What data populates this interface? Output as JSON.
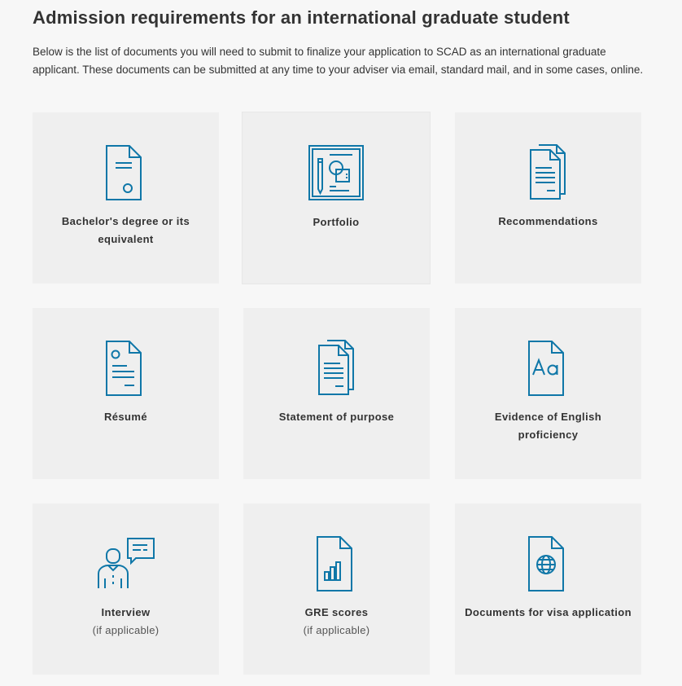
{
  "page": {
    "title": "Admission requirements for an international graduate student",
    "intro": "Below is the list of documents you will need to submit to finalize your application to SCAD as an international graduate applicant. These documents can be submitted at any time to your adviser via email, standard mail, and in some cases, online."
  },
  "theme": {
    "accent": "#0f77a8",
    "card_background": "#efefef",
    "page_background": "#f7f7f7"
  },
  "requirements": [
    {
      "label": "Bachelor's degree or its equivalent",
      "note": "",
      "icon": "diploma-document-icon"
    },
    {
      "label": "Portfolio",
      "note": "",
      "icon": "portfolio-drawing-icon"
    },
    {
      "label": "Recommendations",
      "note": "",
      "icon": "stacked-letters-icon"
    },
    {
      "label": "Résumé",
      "note": "",
      "icon": "resume-document-icon"
    },
    {
      "label": "Statement of purpose",
      "note": "",
      "icon": "stacked-documents-icon"
    },
    {
      "label": "Evidence of English proficiency",
      "note": "",
      "icon": "language-aa-document-icon"
    },
    {
      "label": "Interview",
      "note": "(if applicable)",
      "icon": "interview-person-speech-icon"
    },
    {
      "label": "GRE scores",
      "note": "(if applicable)",
      "icon": "bar-chart-document-icon"
    },
    {
      "label": "Documents for visa application",
      "note": "",
      "icon": "globe-document-icon"
    }
  ]
}
